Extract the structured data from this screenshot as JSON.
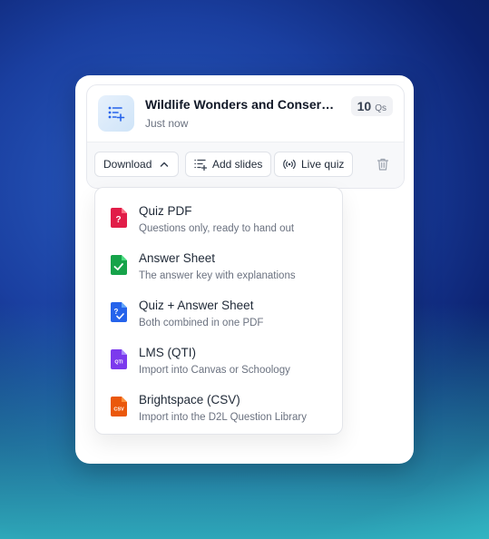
{
  "quiz": {
    "title": "Wildlife Wonders and Conservation",
    "timestamp": "Just now",
    "question_count": "10",
    "question_unit": "Qs"
  },
  "toolbar": {
    "download_label": "Download",
    "add_slides_label": "Add slides",
    "live_quiz_label": "Live quiz"
  },
  "download_menu": {
    "items": [
      {
        "title": "Quiz PDF",
        "description": "Questions only, ready to hand out",
        "icon": "file-question-icon",
        "color": "#e11d48",
        "badge": "?"
      },
      {
        "title": "Answer Sheet",
        "description": "The answer key with explanations",
        "icon": "file-check-icon",
        "color": "#16a34a",
        "badge": "✓"
      },
      {
        "title": "Quiz + Answer Sheet",
        "description": "Both combined in one PDF",
        "icon": "file-combined-icon",
        "color": "#2563eb",
        "badge": "?✓"
      },
      {
        "title": "LMS (QTI)",
        "description": "Import into Canvas or Schoology",
        "icon": "file-qti-icon",
        "color": "#7c3aed",
        "badge": "QTI"
      },
      {
        "title": "Brightspace (CSV)",
        "description": "Import into the D2L Question Library",
        "icon": "file-csv-icon",
        "color": "#ea580c",
        "badge": "CSV"
      }
    ]
  }
}
